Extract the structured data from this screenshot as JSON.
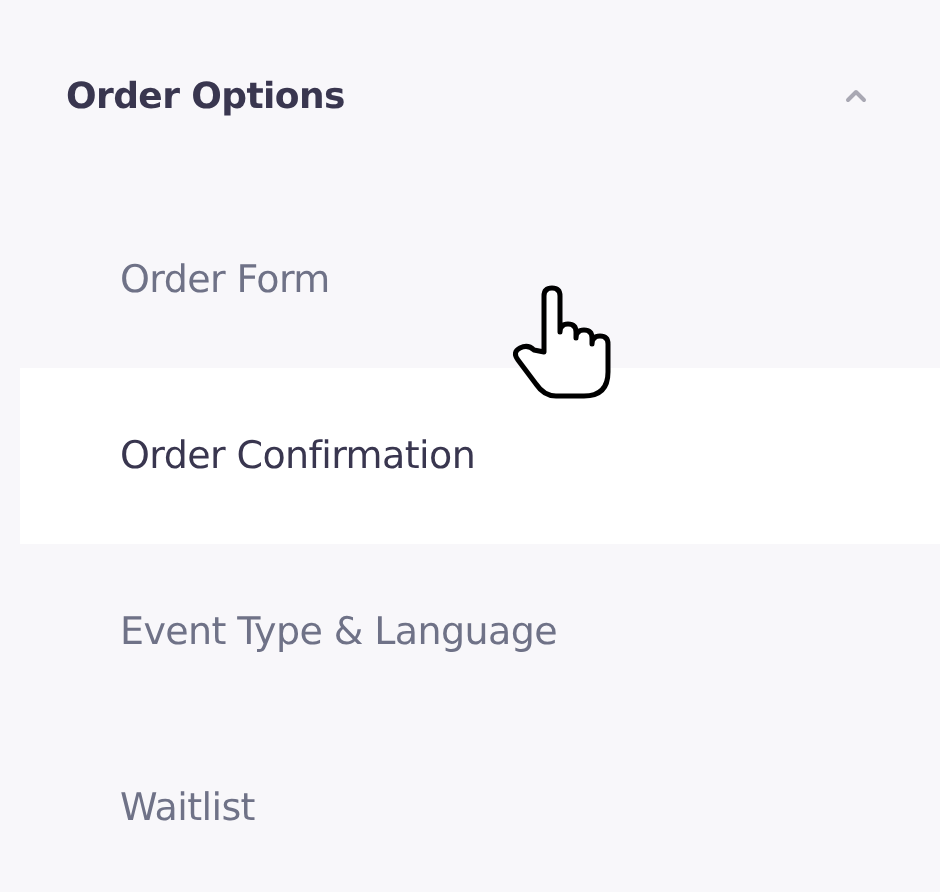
{
  "section": {
    "title": "Order Options",
    "expanded": true,
    "items": [
      {
        "label": "Order Form",
        "selected": false
      },
      {
        "label": "Order Confirmation",
        "selected": true
      },
      {
        "label": "Event Type & Language",
        "selected": false
      },
      {
        "label": "Waitlist",
        "selected": false
      }
    ]
  }
}
